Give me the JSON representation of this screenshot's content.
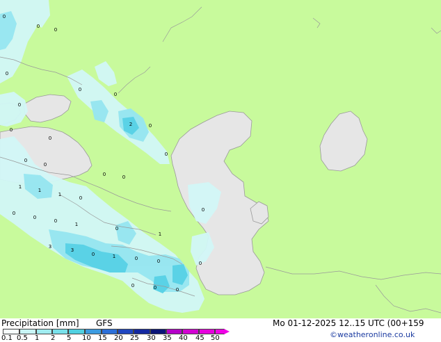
{
  "title": "Precipitation [mm]",
  "model": "GFS",
  "valid_time": "Mo 01-12-2025 12..15 UTC (00+159",
  "credit": "©weatheronline.co.uk",
  "legend": {
    "labels": [
      "0.1",
      "0.5",
      "1",
      "2",
      "5",
      "10",
      "15",
      "20",
      "25",
      "30",
      "35",
      "40",
      "45",
      "50"
    ],
    "colors": [
      "#f5fdfd",
      "#c8f5f5",
      "#a0ecf0",
      "#78e0ea",
      "#50d0e0",
      "#3c9be0",
      "#2c6fd8",
      "#2046c0",
      "#1428a0",
      "#0a1478",
      "#b400c8",
      "#d200d2",
      "#e600dc",
      "#f000e6"
    ]
  },
  "colors": {
    "land": "#c8fa9c",
    "sea": "#e6e6e6",
    "coast": "#999999",
    "light_precip": "#d2f7f7",
    "moderate_precip": "#96e6f0",
    "heavy_precip": "#5ad2e6"
  },
  "map_values": [
    "0",
    "0",
    "0",
    "0",
    "0",
    "0",
    "0",
    "2",
    "0",
    "0",
    "0",
    "0",
    "0",
    "0",
    "0",
    "0",
    "1",
    "1",
    "1",
    "0",
    "0",
    "0",
    "0",
    "0",
    "1",
    "0",
    "1",
    "3",
    "3",
    "0",
    "1",
    "0",
    "0",
    "0",
    "0",
    "0",
    "0"
  ]
}
